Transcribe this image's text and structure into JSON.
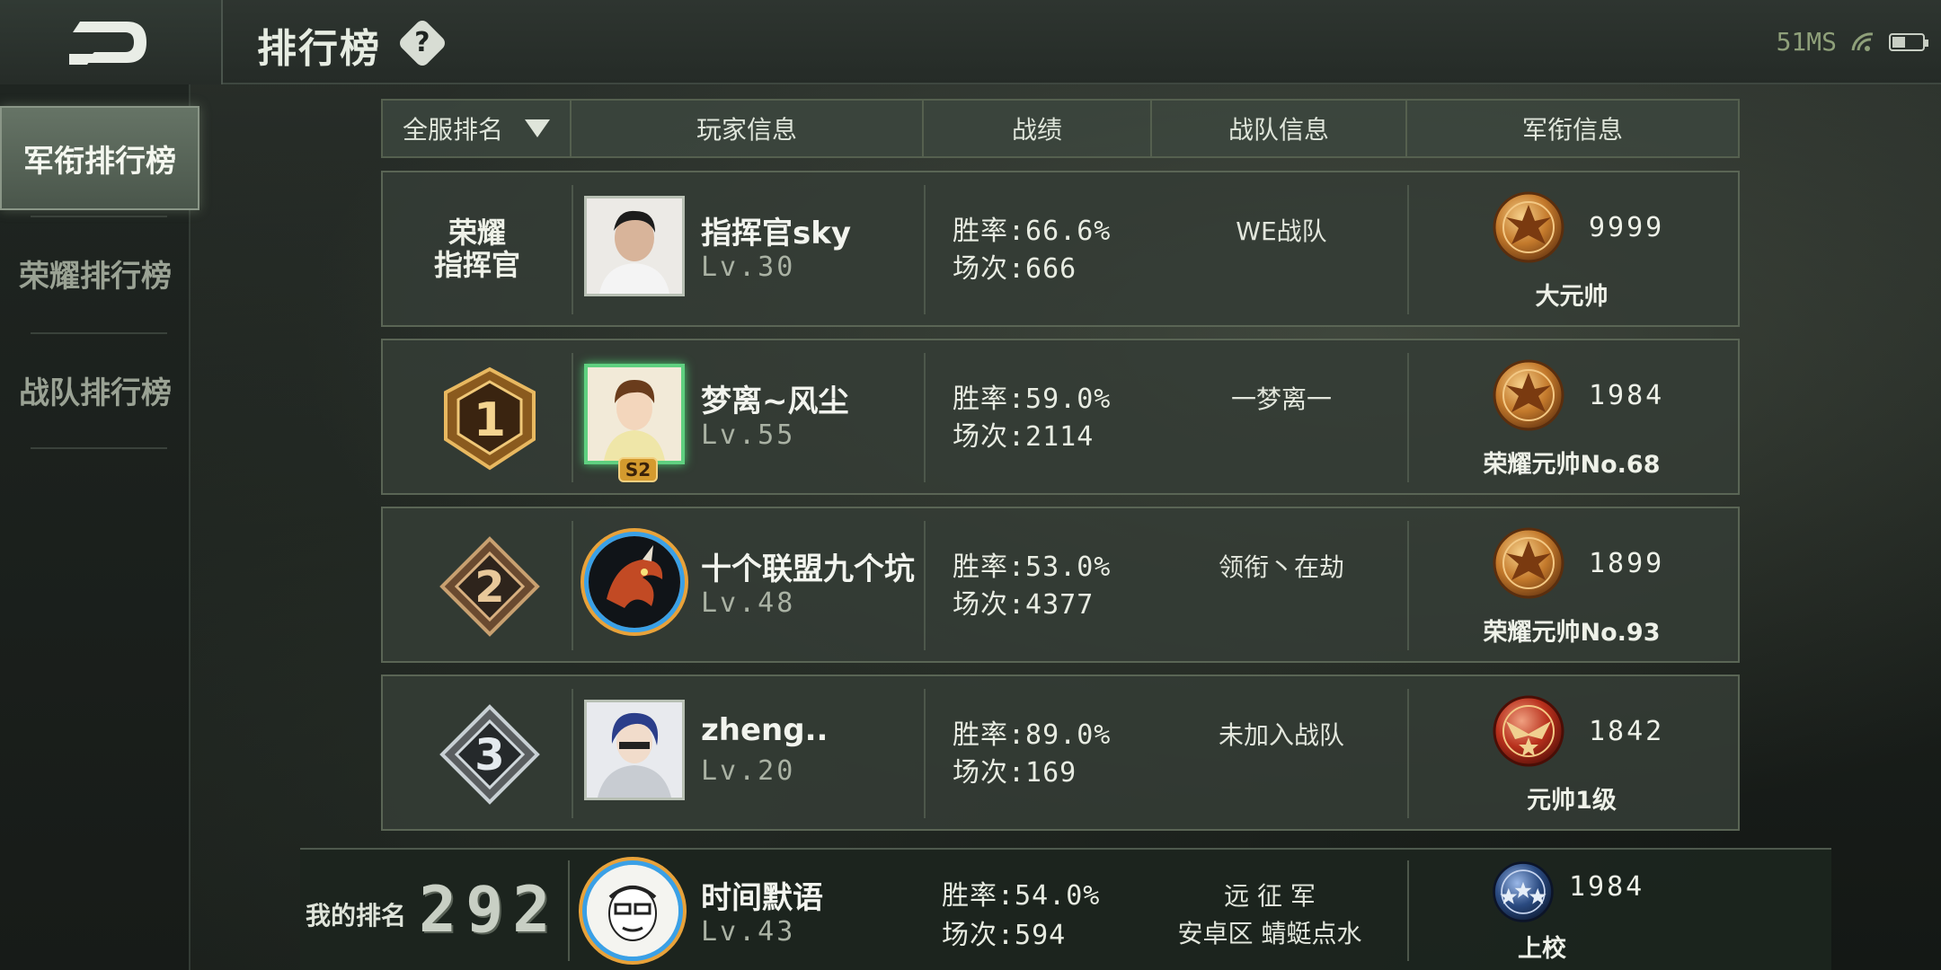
{
  "header": {
    "title": "排行榜",
    "help_symbol": "?",
    "status_signal": "51MS",
    "back_icon": "back-arrow-icon"
  },
  "sidebar": {
    "items": [
      {
        "label": "军衔排行榜",
        "active": true
      },
      {
        "label": "荣耀排行榜",
        "active": false
      },
      {
        "label": "战队排行榜",
        "active": false
      }
    ]
  },
  "table": {
    "headers": {
      "rank": "全服排名",
      "player": "玩家信息",
      "record": "战绩",
      "team": "战队信息",
      "rank_info": "军衔信息"
    },
    "rows": [
      {
        "rank_label": "荣耀\n指挥官",
        "rank_line1": "荣耀",
        "rank_line2": "指挥官",
        "name": "指挥官sky",
        "level": "Lv.30",
        "winrate": "胜率:66.6%",
        "matches": "场次:666",
        "team": "WE战队",
        "score": "9999",
        "military_rank": "大元帅",
        "badge": "gold-eagle-icon"
      },
      {
        "rank_number": "1",
        "name": "梦离~风尘",
        "level": "Lv.55",
        "winrate": "胜率:59.0%",
        "matches": "场次:2114",
        "team": "一梦离一",
        "score": "1984",
        "military_rank": "荣耀元帅No.68",
        "avatar_tag": "S2",
        "badge": "gold-eagle-icon"
      },
      {
        "rank_number": "2",
        "name": "十个联盟九个坑",
        "level": "Lv.48",
        "winrate": "胜率:53.0%",
        "matches": "场次:4377",
        "team": "领衔丶在劫",
        "score": "1899",
        "military_rank": "荣耀元帅No.93",
        "badge": "gold-eagle-icon"
      },
      {
        "rank_number": "3",
        "name": "zheng..",
        "level": "Lv.20",
        "winrate": "胜率:89.0%",
        "matches": "场次:169",
        "team": "未加入战队",
        "score": "1842",
        "military_rank": "元帅1级",
        "badge": "red-eagle-icon"
      }
    ]
  },
  "my_rank": {
    "label": "我的排名",
    "rank": "292",
    "name": "时间默语",
    "level": "Lv.43",
    "winrate": "胜率:54.0%",
    "matches": "场次:594",
    "team_line1": "远 征 军",
    "team_line2": "安卓区 蜻蜓点水",
    "score": "1984",
    "military_rank": "上校",
    "badge": "blue-stars-icon"
  },
  "colors": {
    "gold": "#c98a3a",
    "panel": "#343c36",
    "accent_green": "#5fd080"
  }
}
